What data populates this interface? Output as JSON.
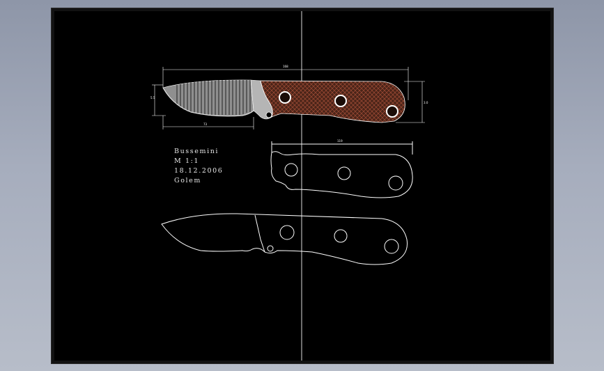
{
  "drawing": {
    "title_block": {
      "name": "Bussemini",
      "scale": "M 1:1",
      "date": "18.12.2006",
      "author": "Golem"
    },
    "dimensions": {
      "overall_length": "168",
      "blade_length": "73",
      "handle_length": "119",
      "blade_height": "5.5",
      "handle_height": "3.0"
    }
  },
  "colors": {
    "background": "#000000",
    "outline": "#ffffff",
    "handle_fill": "#4a2418",
    "hatch": "#9c4a34",
    "steel": "#9a9a9a",
    "guide": "#dcdcdc"
  }
}
